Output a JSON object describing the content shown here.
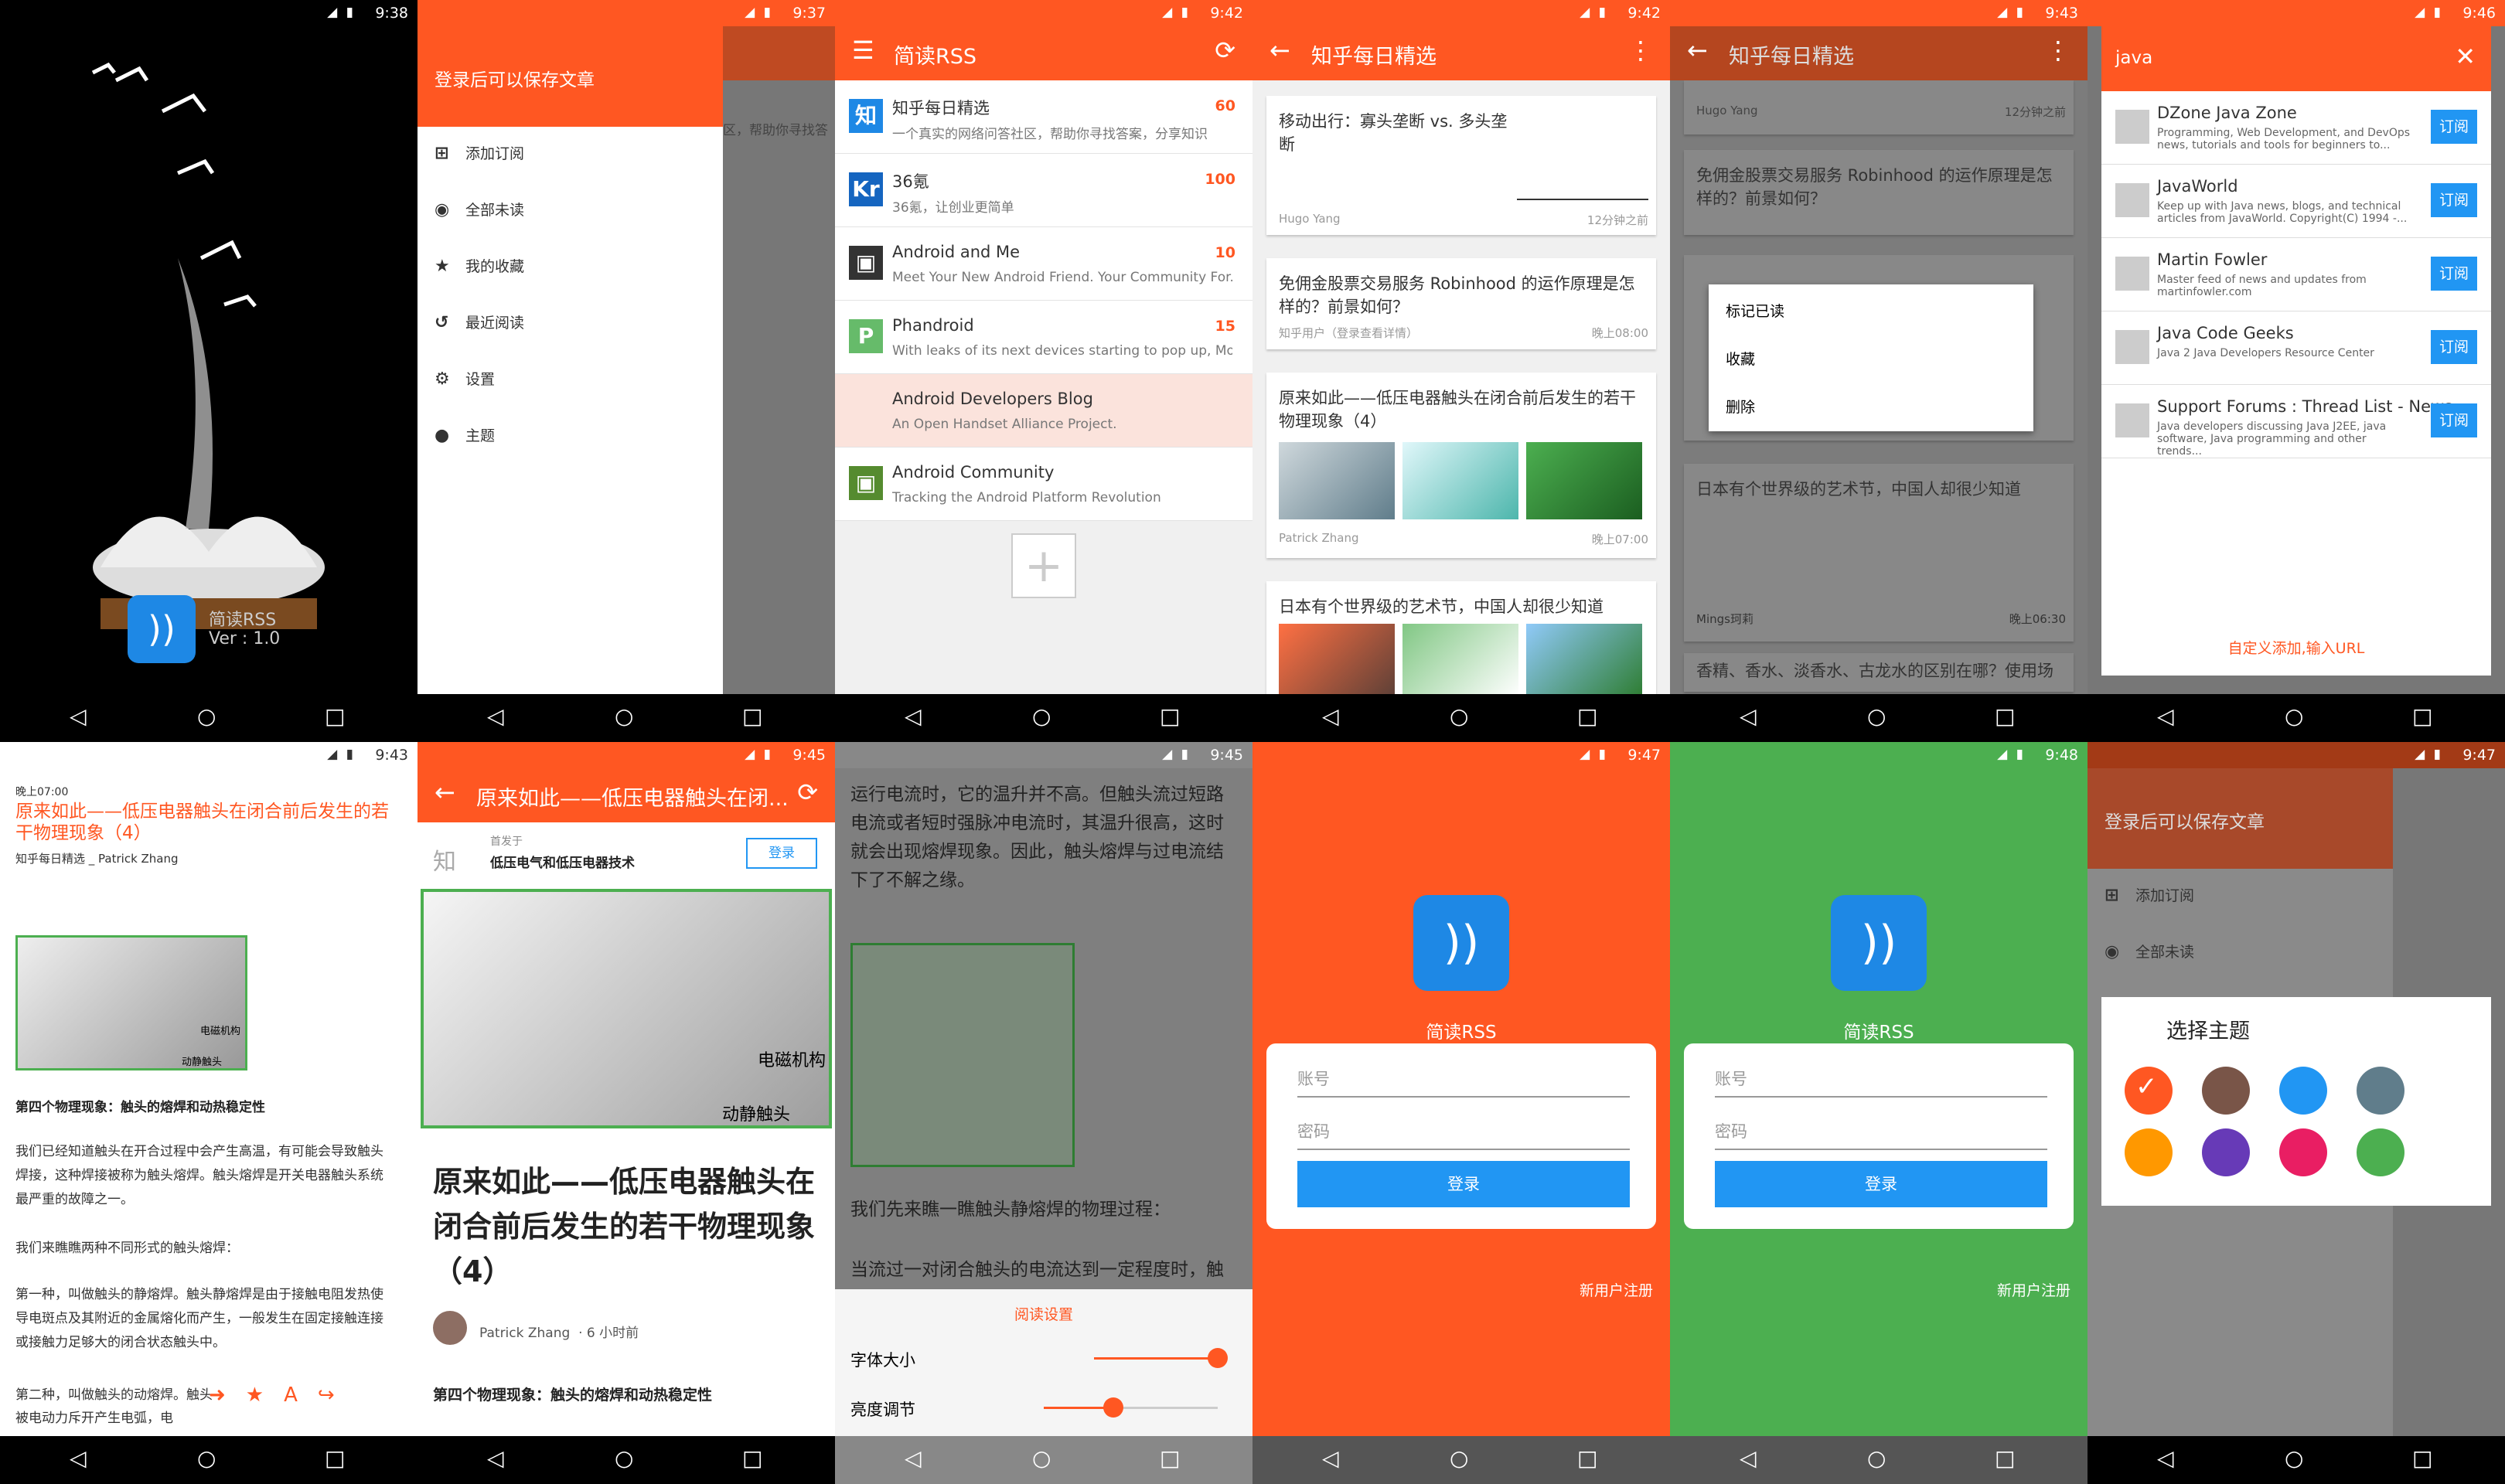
{
  "status": {
    "t1": "9:38",
    "t2": "9:37",
    "t3": "9:42",
    "t4": "9:42",
    "t5": "9:43",
    "t6": "9:46",
    "t7": "9:43",
    "t8": "9:45",
    "t9": "9:45",
    "t10": "9:47",
    "t11": "9:48",
    "t12": "9:47"
  },
  "splash": {
    "title": "简读RSS",
    "version": "Ver : 1.0"
  },
  "drawer": {
    "header": "登录后可以保存文章",
    "items": [
      "添加订阅",
      "全部未读",
      "我的收藏",
      "最近阅读",
      "设置",
      "主题"
    ],
    "peek": "区，帮助你寻找答"
  },
  "feeds": {
    "title": "简读RSS",
    "items": [
      {
        "name": "知乎每日精选",
        "desc": "一个真实的网络问答社区，帮助你寻找答案，分享知识",
        "count": "60",
        "icon": "知",
        "color": "#1e88e5"
      },
      {
        "name": "36氪",
        "desc": "36氪，让创业更简单",
        "count": "100",
        "icon": "Kr",
        "color": "#1565c0"
      },
      {
        "name": "Android and Me",
        "desc": "Meet Your New Android Friend.  Your Community For...",
        "count": "10",
        "icon": "▣",
        "color": "#333"
      },
      {
        "name": "Phandroid",
        "desc": "With leaks of its next devices starting to pop up, Mot...",
        "count": "15",
        "icon": "P",
        "color": "#66bb6a"
      },
      {
        "name": "Android Developers Blog",
        "desc": "An Open Handset Alliance Project.",
        "count": "",
        "icon": "",
        "color": "#fbe3dc"
      },
      {
        "name": "Android Community",
        "desc": "Tracking the Android Platform Revolution",
        "count": "",
        "icon": "▣",
        "color": "#558b2f"
      }
    ]
  },
  "articles": {
    "title": "知乎每日精选",
    "items": [
      {
        "title": "移动出行：寡头垄断 vs. 多头垄断",
        "author": "Hugo Yang",
        "time": "12分钟之前"
      },
      {
        "title": "免佣金股票交易服务 Robinhood 的运作原理是怎样的？前景如何？",
        "author": "知乎用户（登录查看详情）",
        "time": "晚上08:00"
      },
      {
        "title": "原来如此——低压电器触头在闭合前后发生的若干物理现象（4）",
        "author": "Patrick Zhang",
        "time": "晚上07:00"
      },
      {
        "title": "日本有个世界级的艺术节，中国人却很少知道",
        "author": "Mings珂莉",
        "time": "晚上06:30"
      },
      {
        "title": "香精、香水、淡香水、古龙水的区别在哪？使用场",
        "author": "",
        "time": ""
      }
    ]
  },
  "context": {
    "items": [
      "标记已读",
      "收藏",
      "删除"
    ]
  },
  "search": {
    "query": "java",
    "footer": "自定义添加,输入URL",
    "subscribe": "订阅",
    "items": [
      {
        "name": "DZone Java Zone",
        "desc": "Programming, Web Development, and DevOps news, tutorials and tools for beginners to..."
      },
      {
        "name": "JavaWorld",
        "desc": "Keep up with Java news, blogs, and technical articles from JavaWorld. Copyright(C) 1994 -..."
      },
      {
        "name": "Martin Fowler",
        "desc": "Master feed of news and updates from martinfowler.com"
      },
      {
        "name": "Java Code Geeks",
        "desc": "Java 2 Java Developers Resource Center"
      },
      {
        "name": "Support Forums : Thread List - News",
        "desc": "Java developers discussing Java J2EE, java software, Java programming and other trends..."
      }
    ]
  },
  "reader": {
    "time": "晚上07:00",
    "title": "原来如此——低压电器触头在闭合前后发生的若干物理现象（4）",
    "meta": "知乎每日精选 _ Patrick Zhang",
    "heading": "第四个物理现象：触头的熔焊和动热稳定性",
    "p1": "我们已经知道触头在开合过程中会产生高温，有可能会导致触头焊接，这种焊接被称为触头熔焊。触头熔焊是开关电器触头系统最严重的故障之一。",
    "p2": "我们来瞧瞧两种不同形式的触头熔焊：",
    "p3": "第一种，叫做触头的静熔焊。触头静熔焊是由于接触电阻发热使导电斑点及其附近的金属熔化而产生，一般发生在固定接触连接或接触力足够大的闭合状态触头中。",
    "p4": "第二种，叫做触头的动熔焊。触头被电动力斥开产生电弧，电",
    "lbl1": "电磁机构",
    "lbl2": "动静触头"
  },
  "web": {
    "title": "原来如此——低压电器触头在闭...",
    "source": "首发于",
    "column": "低压电气和低压电器技术",
    "login": "登录",
    "zhi": "知",
    "headline": "原来如此——低压电器触头在闭合前后发生的若干物理现象（4）",
    "author": "Patrick Zhang",
    "ago": "6 小时前",
    "section": "第四个物理现象：触头的熔焊和动热稳定性",
    "lbl1": "电磁机构",
    "lbl2": "动静触头"
  },
  "settings": {
    "text1": "运行电流时，它的温升并不高。但触头流过短路电流或者短时强脉冲电流时，其温升很高，这时就会出现熔焊现象。因此，触头熔焊与过电流结下了不解之缘。",
    "text2": "我们先来瞧一瞧触头静熔焊的物理过程：",
    "text3": "当流过一对闭合触头的电流达到一定程度时，触",
    "panel_title": "阅读设置",
    "font": "字体大小",
    "bright": "亮度调节",
    "font_value": 1.0,
    "bright_value": 0.4
  },
  "login": {
    "name": "简读RSS",
    "user": "账号",
    "pass": "密码",
    "btn": "登录",
    "reg": "新用户注册"
  },
  "theme": {
    "title": "选择主题",
    "colors": [
      "#ff5722",
      "#795548",
      "#2196f3",
      "#607d8b",
      "#ff9800",
      "#673ab7",
      "#e91e63",
      "#4caf50"
    ],
    "header": "登录后可以保存文章",
    "items": [
      "添加订阅",
      "全部未读"
    ]
  }
}
